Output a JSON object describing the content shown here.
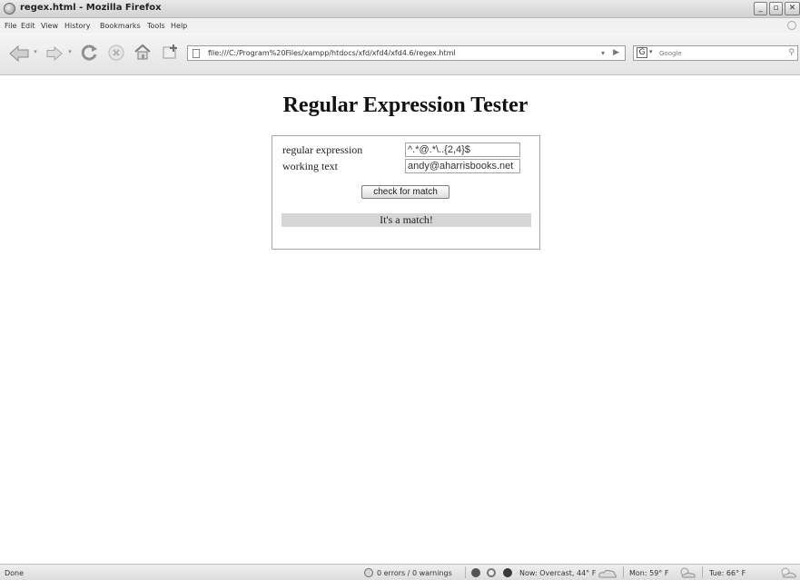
{
  "window": {
    "title": "regex.html - Mozilla Firefox",
    "controls": {
      "minimize": "_",
      "maximize": "▫",
      "close": "✕"
    }
  },
  "menu": {
    "items": [
      {
        "label": "File"
      },
      {
        "label": "Edit"
      },
      {
        "label": "View"
      },
      {
        "label": "History"
      },
      {
        "label": "Bookmarks"
      },
      {
        "label": "Tools"
      },
      {
        "label": "Help"
      }
    ]
  },
  "toolbar": {
    "url": "file:///C:/Program%20Files/xampp/htdocs/xfd/xfd4/xfd4.6/regex.html",
    "search_placeholder": "Google",
    "search_engine": "G"
  },
  "page": {
    "heading": "Regular Expression Tester",
    "regex_label": "regular expression",
    "regex_value": "^.*@.*\\..{2,4}$",
    "text_label": "working text",
    "text_value": "andy@aharrisbooks.net",
    "button_label": "check for match",
    "result": "It's a match!"
  },
  "statusbar": {
    "status": "Done",
    "errors": "0 errors / 0 warnings",
    "weather_now": "Now: Overcast, 44° F",
    "weather_mon": "Mon: 59° F",
    "weather_tue": "Tue: 66° F"
  },
  "colors": {
    "result_background": "#d6d6d6",
    "panel_border": "#a9a9a9"
  }
}
